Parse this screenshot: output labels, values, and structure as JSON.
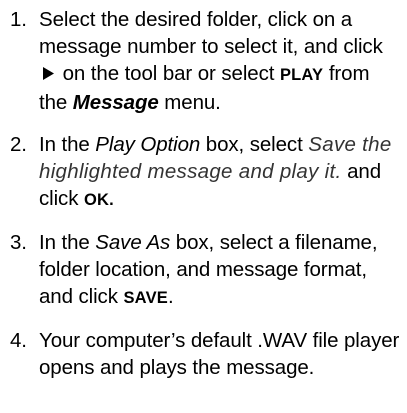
{
  "instructions": {
    "steps": [
      {
        "number": "1.",
        "t1": "Select the desired folder, click on a message number to select it, and click ",
        "icon": "play-icon",
        "t2": " on the tool bar or select ",
        "cmd": "PLAY",
        "t3": " from the ",
        "menu": "Message",
        "t4": " menu."
      },
      {
        "number": "2.",
        "t1": "In the ",
        "box": "Play Option",
        "t2": " box, select ",
        "option": "Save the highlighted message and play it.",
        "t3": " and click ",
        "cmd": "OK."
      },
      {
        "number": "3.",
        "t1": "In the ",
        "box": "Save As",
        "t2": " box, select a filename, folder location, and message format, and click ",
        "cmd": "SAVE",
        "t3": "."
      },
      {
        "number": "4.",
        "t1": "Your computer’s default .WAV file player opens and plays the message."
      }
    ]
  }
}
